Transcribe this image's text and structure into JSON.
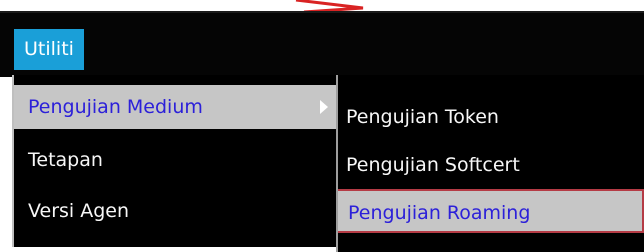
{
  "menubar": {
    "title": "Utiliti"
  },
  "dropdown": {
    "items": [
      {
        "label": "Pengujian Medium"
      },
      {
        "label": "Tetapan"
      },
      {
        "label": "Versi Agen"
      }
    ]
  },
  "submenu": {
    "items": [
      {
        "label": "Pengujian Token"
      },
      {
        "label": "Pengujian Softcert"
      },
      {
        "label": "Pengujian Roaming"
      }
    ]
  },
  "colors": {
    "menubar_bg": "#050505",
    "utiliti_bg": "#1a9fd8",
    "highlight_bg": "#c6c6c6",
    "highlight_text": "#2c20d9",
    "selection_outline": "#b53b45"
  },
  "icons": {
    "submenu_indicator": "chevron-right-icon",
    "top_mark": "red-arrow-icon"
  }
}
